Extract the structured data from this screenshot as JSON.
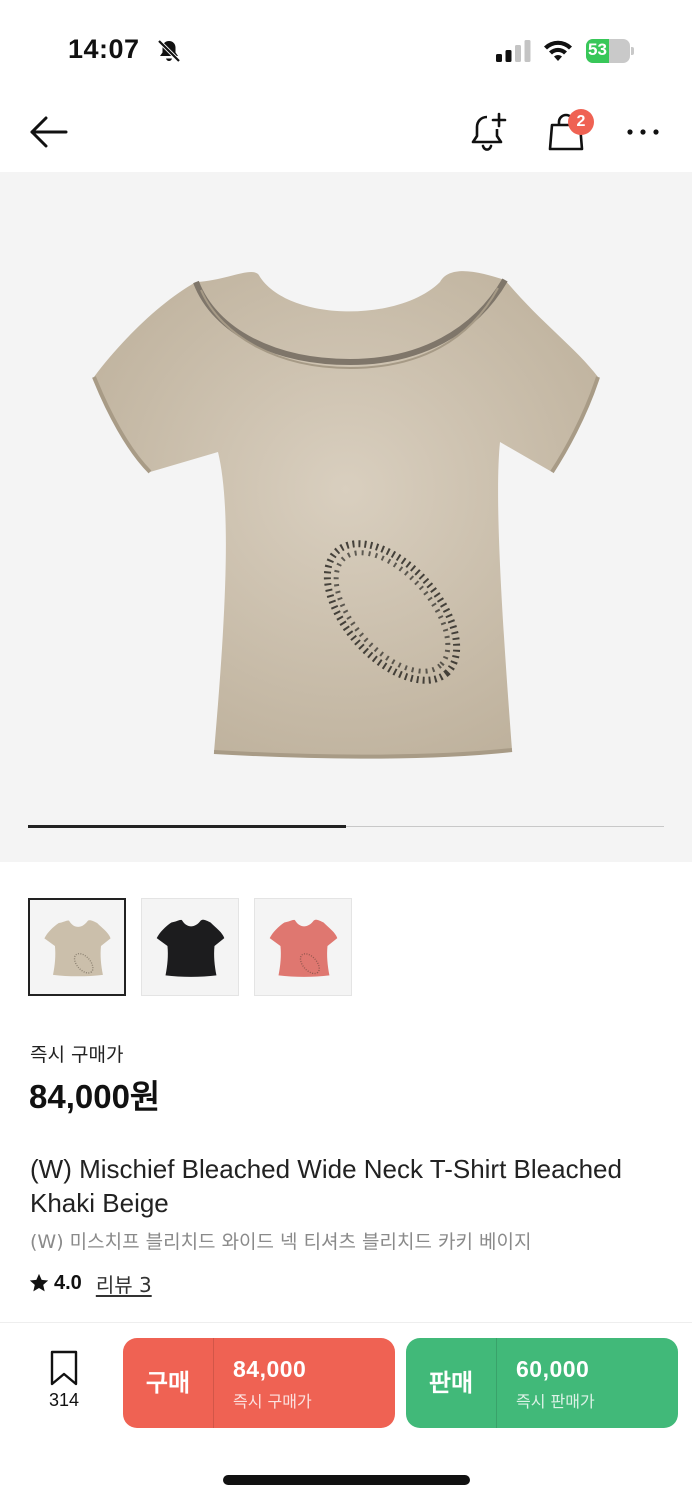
{
  "status_bar": {
    "time": "14:07",
    "battery_level": "53",
    "battery_fraction": 0.53
  },
  "nav": {
    "cart_count": "2",
    "icons": [
      "back-arrow-icon",
      "bell-plus-icon",
      "shopping-bag-icon",
      "more-icon"
    ]
  },
  "gallery": {
    "progress_fraction": 0.5,
    "variants": [
      {
        "color": "#cbbfab",
        "name": "khaki-beige"
      },
      {
        "color": "#1c1c1e",
        "name": "black"
      },
      {
        "color": "#df7770",
        "name": "pink"
      }
    ]
  },
  "product": {
    "price_label": "즉시 구매가",
    "price": "84,000원",
    "title_en": "(W) Mischief Bleached Wide Neck T-Shirt Bleached Khaki Beige",
    "title_ko": "(W) 미스치프 블리치드 와이드 넥 티셔츠 블리치드 카키 베이지",
    "rating": "4.0",
    "review_link": "리뷰 3"
  },
  "bottom_bar": {
    "bookmark_count": "314",
    "buy": {
      "label": "구매",
      "price": "84,000",
      "sub": "즉시 구매가",
      "color": "#ef6253"
    },
    "sell": {
      "label": "판매",
      "price": "60,000",
      "sub": "즉시 판매가",
      "color": "#41b979"
    }
  }
}
